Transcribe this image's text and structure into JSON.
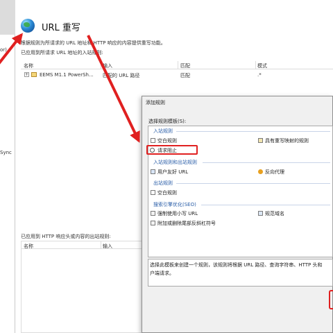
{
  "left_panel": {
    "labels": [
      "or)",
      "Sync"
    ]
  },
  "header": {
    "title": "URL 重写",
    "description": "根据规则为所请求的 URL 地址和 HTTP 响应的内容提供重写功能。",
    "inbound_label": "已应用到所请求 URL 地址的入站规则:"
  },
  "inbound_grid": {
    "columns": [
      "名称",
      "输入",
      "匹配",
      "模式"
    ],
    "row": {
      "expand": "+",
      "name": "EEMS M1.1 PowerSh...",
      "input": "匹配的 URL 路径",
      "match": "匹配",
      "pattern": ".*"
    }
  },
  "outbound": {
    "label": "已应用到 HTTP 响应头或内容的出站规则:",
    "columns": [
      "名称",
      "输入"
    ]
  },
  "dialog": {
    "title": "添加规则",
    "choose_label": "选择规则模板(S):",
    "groups": {
      "inbound": "入站规则",
      "inout": "入站规则和出站规则",
      "outbound": "出站规则",
      "seo": "搜索引擎优化(SEO)"
    },
    "items": {
      "blank": "空白规则",
      "rewrite_map": "具有重写映射的规则",
      "block": "请求阻止",
      "friendly_url": "用户友好 URL",
      "reverse_proxy": "反向代理",
      "out_blank": "空白规则",
      "lowercase": "强制使用小写 URL",
      "canonical": "规范域名",
      "trailing_slash": "附加或删除尾部反斜杠符号"
    },
    "help": [
      "选择此模板来创建一个规则，该规则将根据 URL 路径、查询字符串、HTTP 头和",
      "户端请求。"
    ]
  },
  "colors": {
    "highlight": "#e02020",
    "group_text": "#2a5ea8"
  }
}
